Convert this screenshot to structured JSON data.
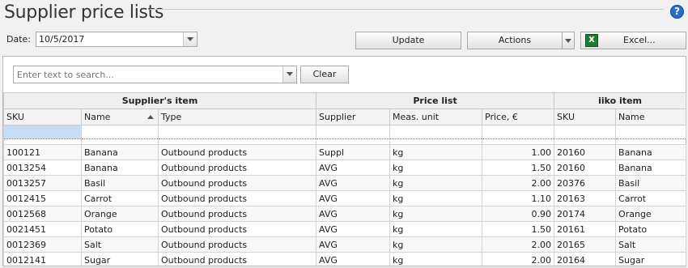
{
  "header": {
    "title": "Supplier price lists",
    "help": "?"
  },
  "toolbar": {
    "date_label": "Date:",
    "date_value": "10/5/2017",
    "update_label": "Update",
    "actions_label": "Actions",
    "excel_label": "Excel...",
    "excel_icon_glyph": "X"
  },
  "search": {
    "placeholder": "Enter text to search...",
    "clear_label": "Clear"
  },
  "grid": {
    "bands": [
      "Supplier's item",
      "Price list",
      "iiko item"
    ],
    "columns": [
      "SKU",
      "Name",
      "Type",
      "Supplier",
      "Meas. unit",
      "Price, €",
      "SKU",
      "Name"
    ],
    "rows": [
      [
        "100121",
        "Banana",
        "Outbound products",
        "Suppl",
        "kg",
        "1.00",
        "20160",
        "Banana"
      ],
      [
        "0013254",
        "Banana",
        "Outbound products",
        "AVG",
        "kg",
        "1.50",
        "20160",
        "Banana"
      ],
      [
        "0013257",
        "Basil",
        "Outbound products",
        "AVG",
        "kg",
        "2.00",
        "20376",
        "Basil"
      ],
      [
        "0012415",
        "Carrot",
        "Outbound products",
        "AVG",
        "kg",
        "1.10",
        "20163",
        "Carrot"
      ],
      [
        "0012568",
        "Orange",
        "Outbound products",
        "AVG",
        "kg",
        "0.90",
        "20174",
        "Orange"
      ],
      [
        "0021451",
        "Potato",
        "Outbound products",
        "AVG",
        "kg",
        "1.50",
        "20161",
        "Potato"
      ],
      [
        "0012369",
        "Salt",
        "Outbound products",
        "AVG",
        "kg",
        "2.00",
        "20165",
        "Salt"
      ],
      [
        "0012141",
        "Sugar",
        "Outbound products",
        "AVG",
        "kg",
        "2.00",
        "20164",
        "Sugar"
      ]
    ]
  }
}
